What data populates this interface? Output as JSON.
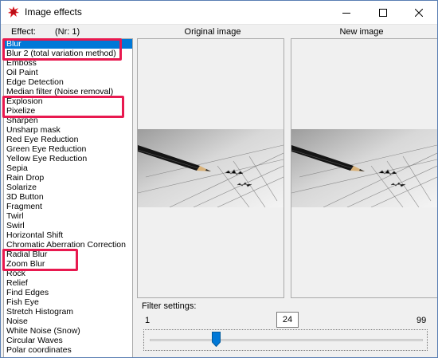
{
  "window": {
    "title": "Image effects"
  },
  "labels": {
    "effect_prefix": "Effect:",
    "effect_count": "(Nr: 1)",
    "original_image": "Original image",
    "new_image": "New image",
    "filter_settings": "Filter settings:"
  },
  "effects": [
    "Blur",
    "Blur 2 (total variation method)",
    "Emboss",
    "Oil Paint",
    "Edge Detection",
    "Median filter (Noise removal)",
    "Explosion",
    "Pixelize",
    "Sharpen",
    "Unsharp mask",
    "Red Eye Reduction",
    "Green Eye Reduction",
    "Yellow Eye Reduction",
    "Sepia",
    "Rain Drop",
    "Solarize",
    "3D Button",
    "Fragment",
    "Twirl",
    "Swirl",
    "Horizontal Shift",
    "Chromatic Aberration Correction",
    "Radial Blur",
    "Zoom Blur",
    "Rock",
    "Relief",
    "Find Edges",
    "Fish Eye",
    "Stretch Histogram",
    "Noise",
    "White Noise (Snow)",
    "Circular Waves",
    "Polar coordinates"
  ],
  "selected_effect": "Blur",
  "highlighted_effects": [
    "Blur",
    "Blur 2 (total variation method)",
    "Explosion",
    "Pixelize",
    "Radial Blur",
    "Zoom Blur"
  ],
  "slider": {
    "min": "1",
    "max": "99",
    "value": "24"
  },
  "colors": {
    "selection": "#0078d7",
    "highlight": "#e8194f"
  }
}
